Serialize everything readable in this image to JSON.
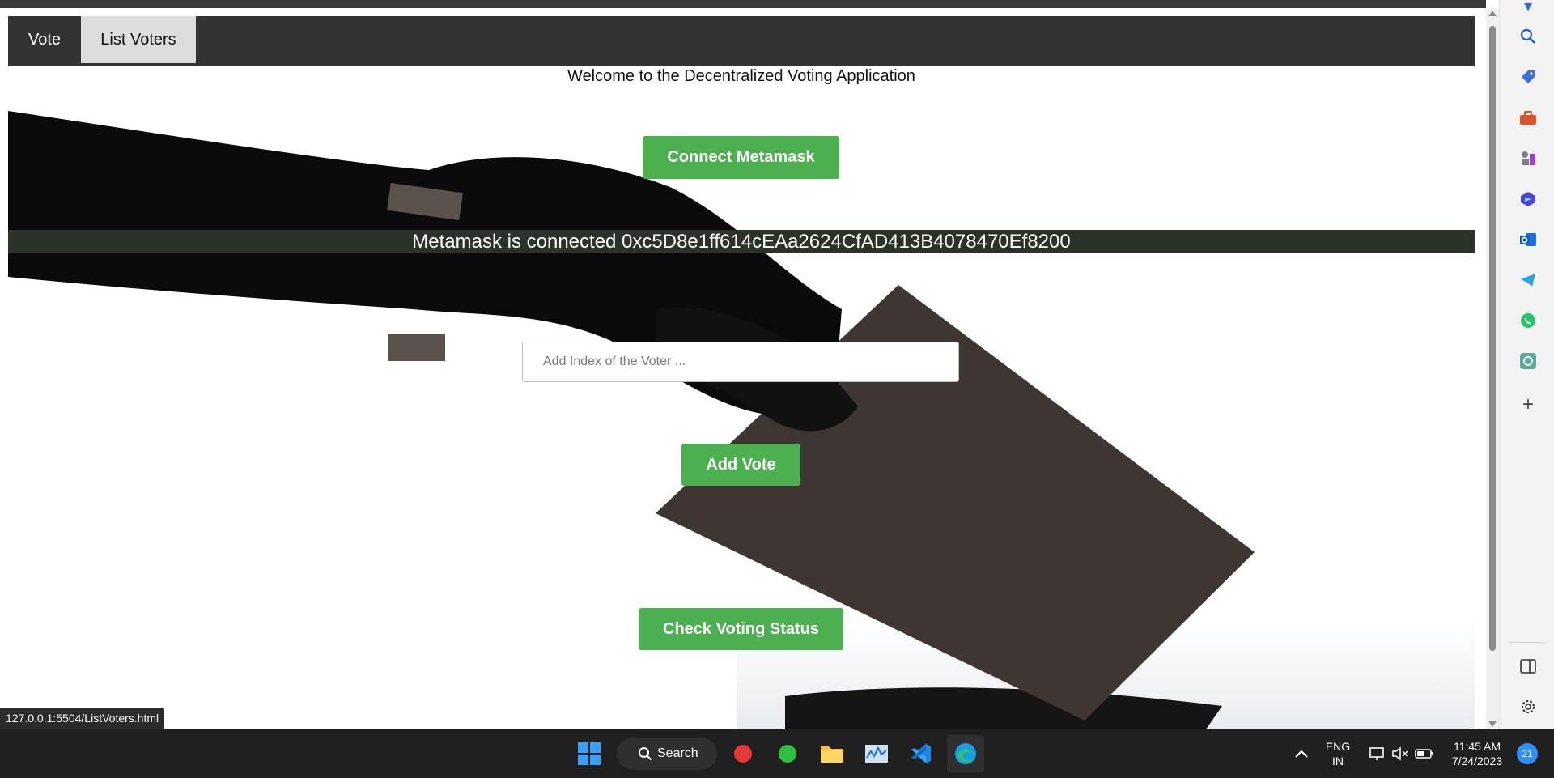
{
  "nav": {
    "tabs": [
      {
        "label": "Vote",
        "active": false
      },
      {
        "label": "List Voters",
        "active": true
      }
    ]
  },
  "main": {
    "welcome": "Welcome to the Decentralized Voting Application",
    "connect_button": "Connect Metamask",
    "status_message": "Metamask is connected 0xc5D8e1ff614cEAa2624CfAD413B4078470Ef8200",
    "voter_index_placeholder": "Add Index of the Voter ...",
    "add_vote_button": "Add Vote",
    "check_status_button": "Check Voting Status",
    "accent_color": "#4caf50"
  },
  "browser": {
    "status_url": "127.0.0.1:5504/ListVoters.html",
    "sidebar_icons": [
      "search-icon",
      "tag-icon",
      "toolbox-icon",
      "chess-icon",
      "copilot-icon",
      "outlook-icon",
      "telegram-icon",
      "whatsapp-icon",
      "chatgpt-icon",
      "add-icon",
      "split-screen-icon",
      "settings-icon"
    ]
  },
  "taskbar": {
    "search_label": "Search",
    "language_line1": "ENG",
    "language_line2": "IN",
    "time": "11:45 AM",
    "date": "7/24/2023",
    "notification_count": "21"
  }
}
